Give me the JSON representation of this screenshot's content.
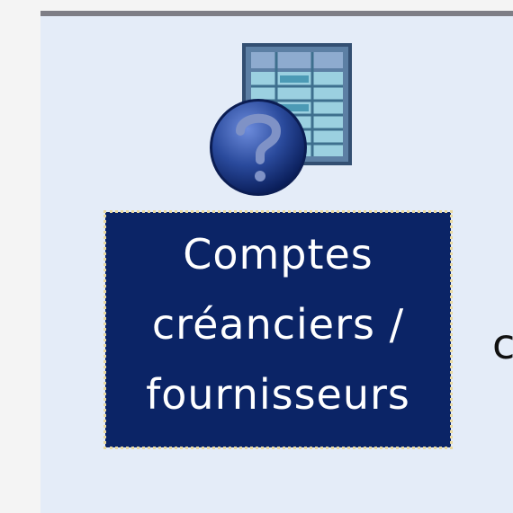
{
  "desktop": {
    "shortcut": {
      "icon": "help-spreadsheet-icon",
      "label_lines": [
        "Comptes",
        "créanciers /",
        "fournisseurs"
      ]
    },
    "next_item_fragment": "c"
  },
  "colors": {
    "panel_background": "#e4ecf8",
    "selection_background": "#0b2466",
    "selection_text": "#ffffff",
    "focus_outline": "#e8d8a0",
    "top_border": "#7e7e86"
  }
}
